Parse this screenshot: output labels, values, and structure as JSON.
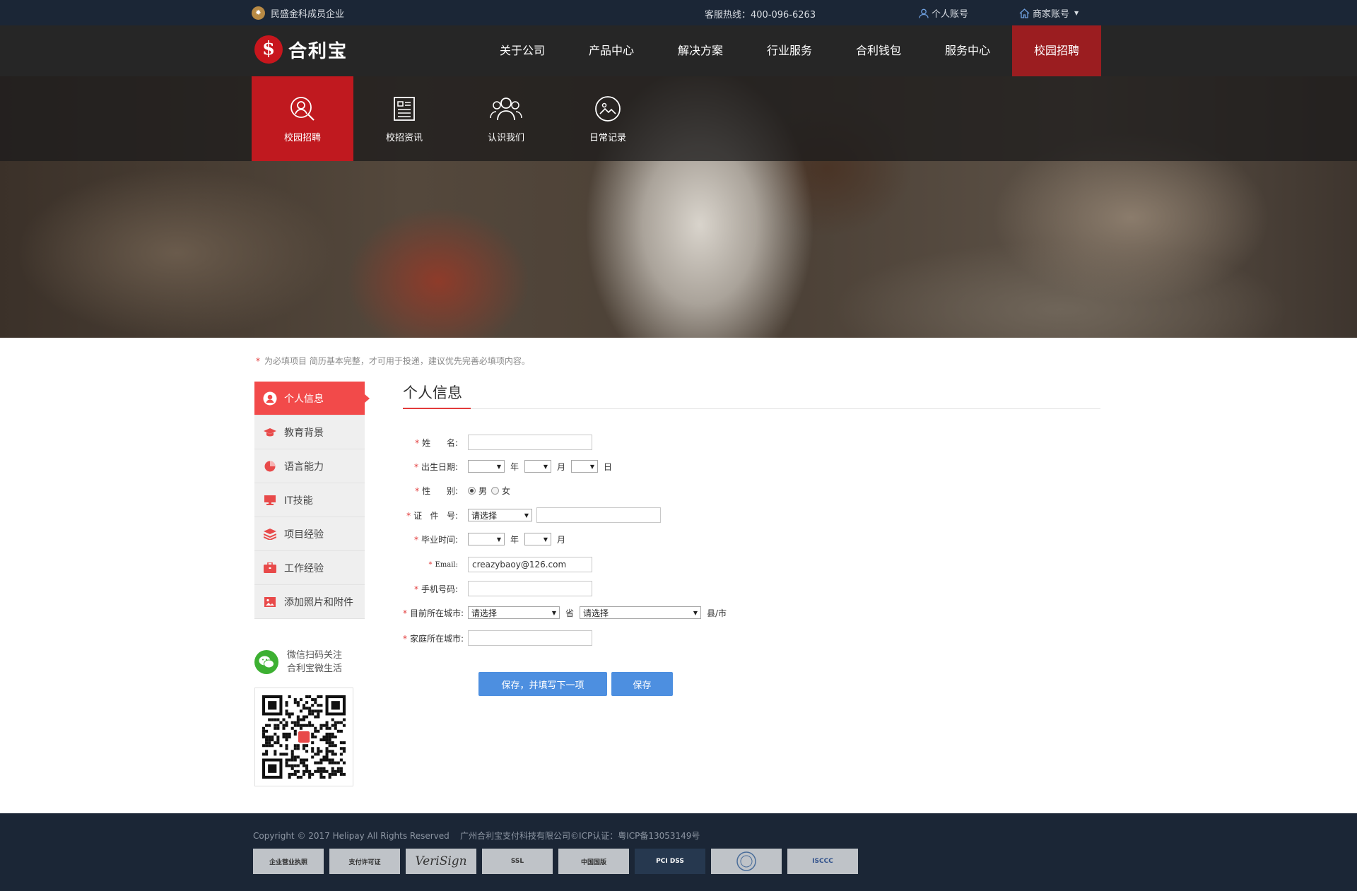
{
  "topbar": {
    "member": "民盛金科成员企业",
    "hotline": "客服热线：400-096-6263",
    "personal_account": "个人账号",
    "merchant_account": "商家账号"
  },
  "logo": {
    "text": "合利宝"
  },
  "menu": [
    {
      "label": "关于公司"
    },
    {
      "label": "产品中心"
    },
    {
      "label": "解决方案"
    },
    {
      "label": "行业服务"
    },
    {
      "label": "合利钱包"
    },
    {
      "label": "服务中心"
    },
    {
      "label": "校园招聘"
    }
  ],
  "subnav": [
    {
      "label": "校园招聘",
      "icon": "search-person-icon"
    },
    {
      "label": "校招资讯",
      "icon": "news-icon"
    },
    {
      "label": "认识我们",
      "icon": "team-icon"
    },
    {
      "label": "日常记录",
      "icon": "photo-icon"
    }
  ],
  "notice": {
    "required_mark": "*",
    "text": "为必填项目 简历基本完整，才可用于投递，建议优先完善必填项内容。"
  },
  "sidebar": [
    {
      "label": "个人信息"
    },
    {
      "label": "教育背景"
    },
    {
      "label": "语言能力"
    },
    {
      "label": "IT技能"
    },
    {
      "label": "项目经验"
    },
    {
      "label": "工作经验"
    },
    {
      "label": "添加照片和附件"
    }
  ],
  "wechat": {
    "line1": "微信扫码关注",
    "line2": "合利宝微生活"
  },
  "form": {
    "title": "个人信息",
    "required_mark": "*",
    "name_label": "姓      名:",
    "birth_label": "出生日期:",
    "gender_label": "性      别:",
    "id_label": "证   件   号:",
    "grad_label": "毕业时间:",
    "email_label": "Email:",
    "phone_label": "手机号码:",
    "city_label": "目前所在城市:",
    "home_label": "家庭所在城市:",
    "year": "年",
    "month": "月",
    "day": "日",
    "male": "男",
    "female": "女",
    "select_placeholder": "请选择",
    "email_value": "creazybaoy@126.com",
    "province": "省",
    "county": "县/市",
    "save_next": "保存，并填写下一项",
    "save": "保存"
  },
  "footer": {
    "copyright": "Copyright © 2017 Helipay All Rights Reserved    广州合利宝支付科技有限公司©ICP认证：粤ICP备13053149号",
    "certs": [
      "企业营业执照",
      "支付许可证",
      "VeriSign",
      "SSL",
      "中国国版",
      "PCI DSS",
      "",
      "ISCCC"
    ]
  },
  "colors": {
    "brand_red": "#c0191f",
    "active_red": "#f24a4a",
    "button_blue": "#4d8fe0",
    "dark_navy": "#1b2636"
  }
}
